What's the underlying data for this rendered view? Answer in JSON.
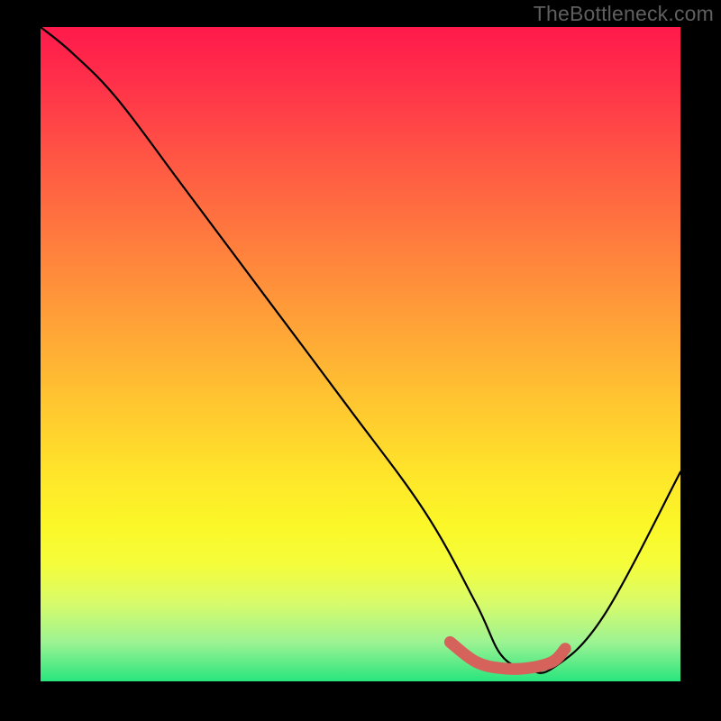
{
  "watermark": "TheBottleneck.com",
  "chart_data": {
    "type": "line",
    "title": "",
    "xlabel": "",
    "ylabel": "",
    "xlim": [
      0,
      100
    ],
    "ylim": [
      0,
      100
    ],
    "grid": false,
    "series": [
      {
        "name": "bottleneck-curve",
        "x": [
          0,
          5,
          12,
          22,
          35,
          48,
          60,
          68,
          72,
          76,
          80,
          88,
          100
        ],
        "y": [
          100,
          96,
          89,
          76,
          59,
          42,
          26,
          12,
          4,
          2,
          2,
          10,
          32
        ],
        "color": "#000000"
      },
      {
        "name": "highlight-segment",
        "x": [
          64,
          68,
          72,
          76,
          80,
          82
        ],
        "y": [
          6,
          3,
          2,
          2,
          3,
          5
        ],
        "color": "#d5635c"
      }
    ],
    "gradient_stops": [
      {
        "pos": 0,
        "color": "#ff1a4b"
      },
      {
        "pos": 8,
        "color": "#ff2f4a"
      },
      {
        "pos": 20,
        "color": "#ff5644"
      },
      {
        "pos": 32,
        "color": "#ff7a3e"
      },
      {
        "pos": 44,
        "color": "#ff9e38"
      },
      {
        "pos": 56,
        "color": "#ffc231"
      },
      {
        "pos": 68,
        "color": "#ffe42a"
      },
      {
        "pos": 76,
        "color": "#fbf728"
      },
      {
        "pos": 82,
        "color": "#f5fd3a"
      },
      {
        "pos": 88,
        "color": "#d8fb6a"
      },
      {
        "pos": 94,
        "color": "#9df393"
      },
      {
        "pos": 100,
        "color": "#28e57e"
      }
    ]
  }
}
